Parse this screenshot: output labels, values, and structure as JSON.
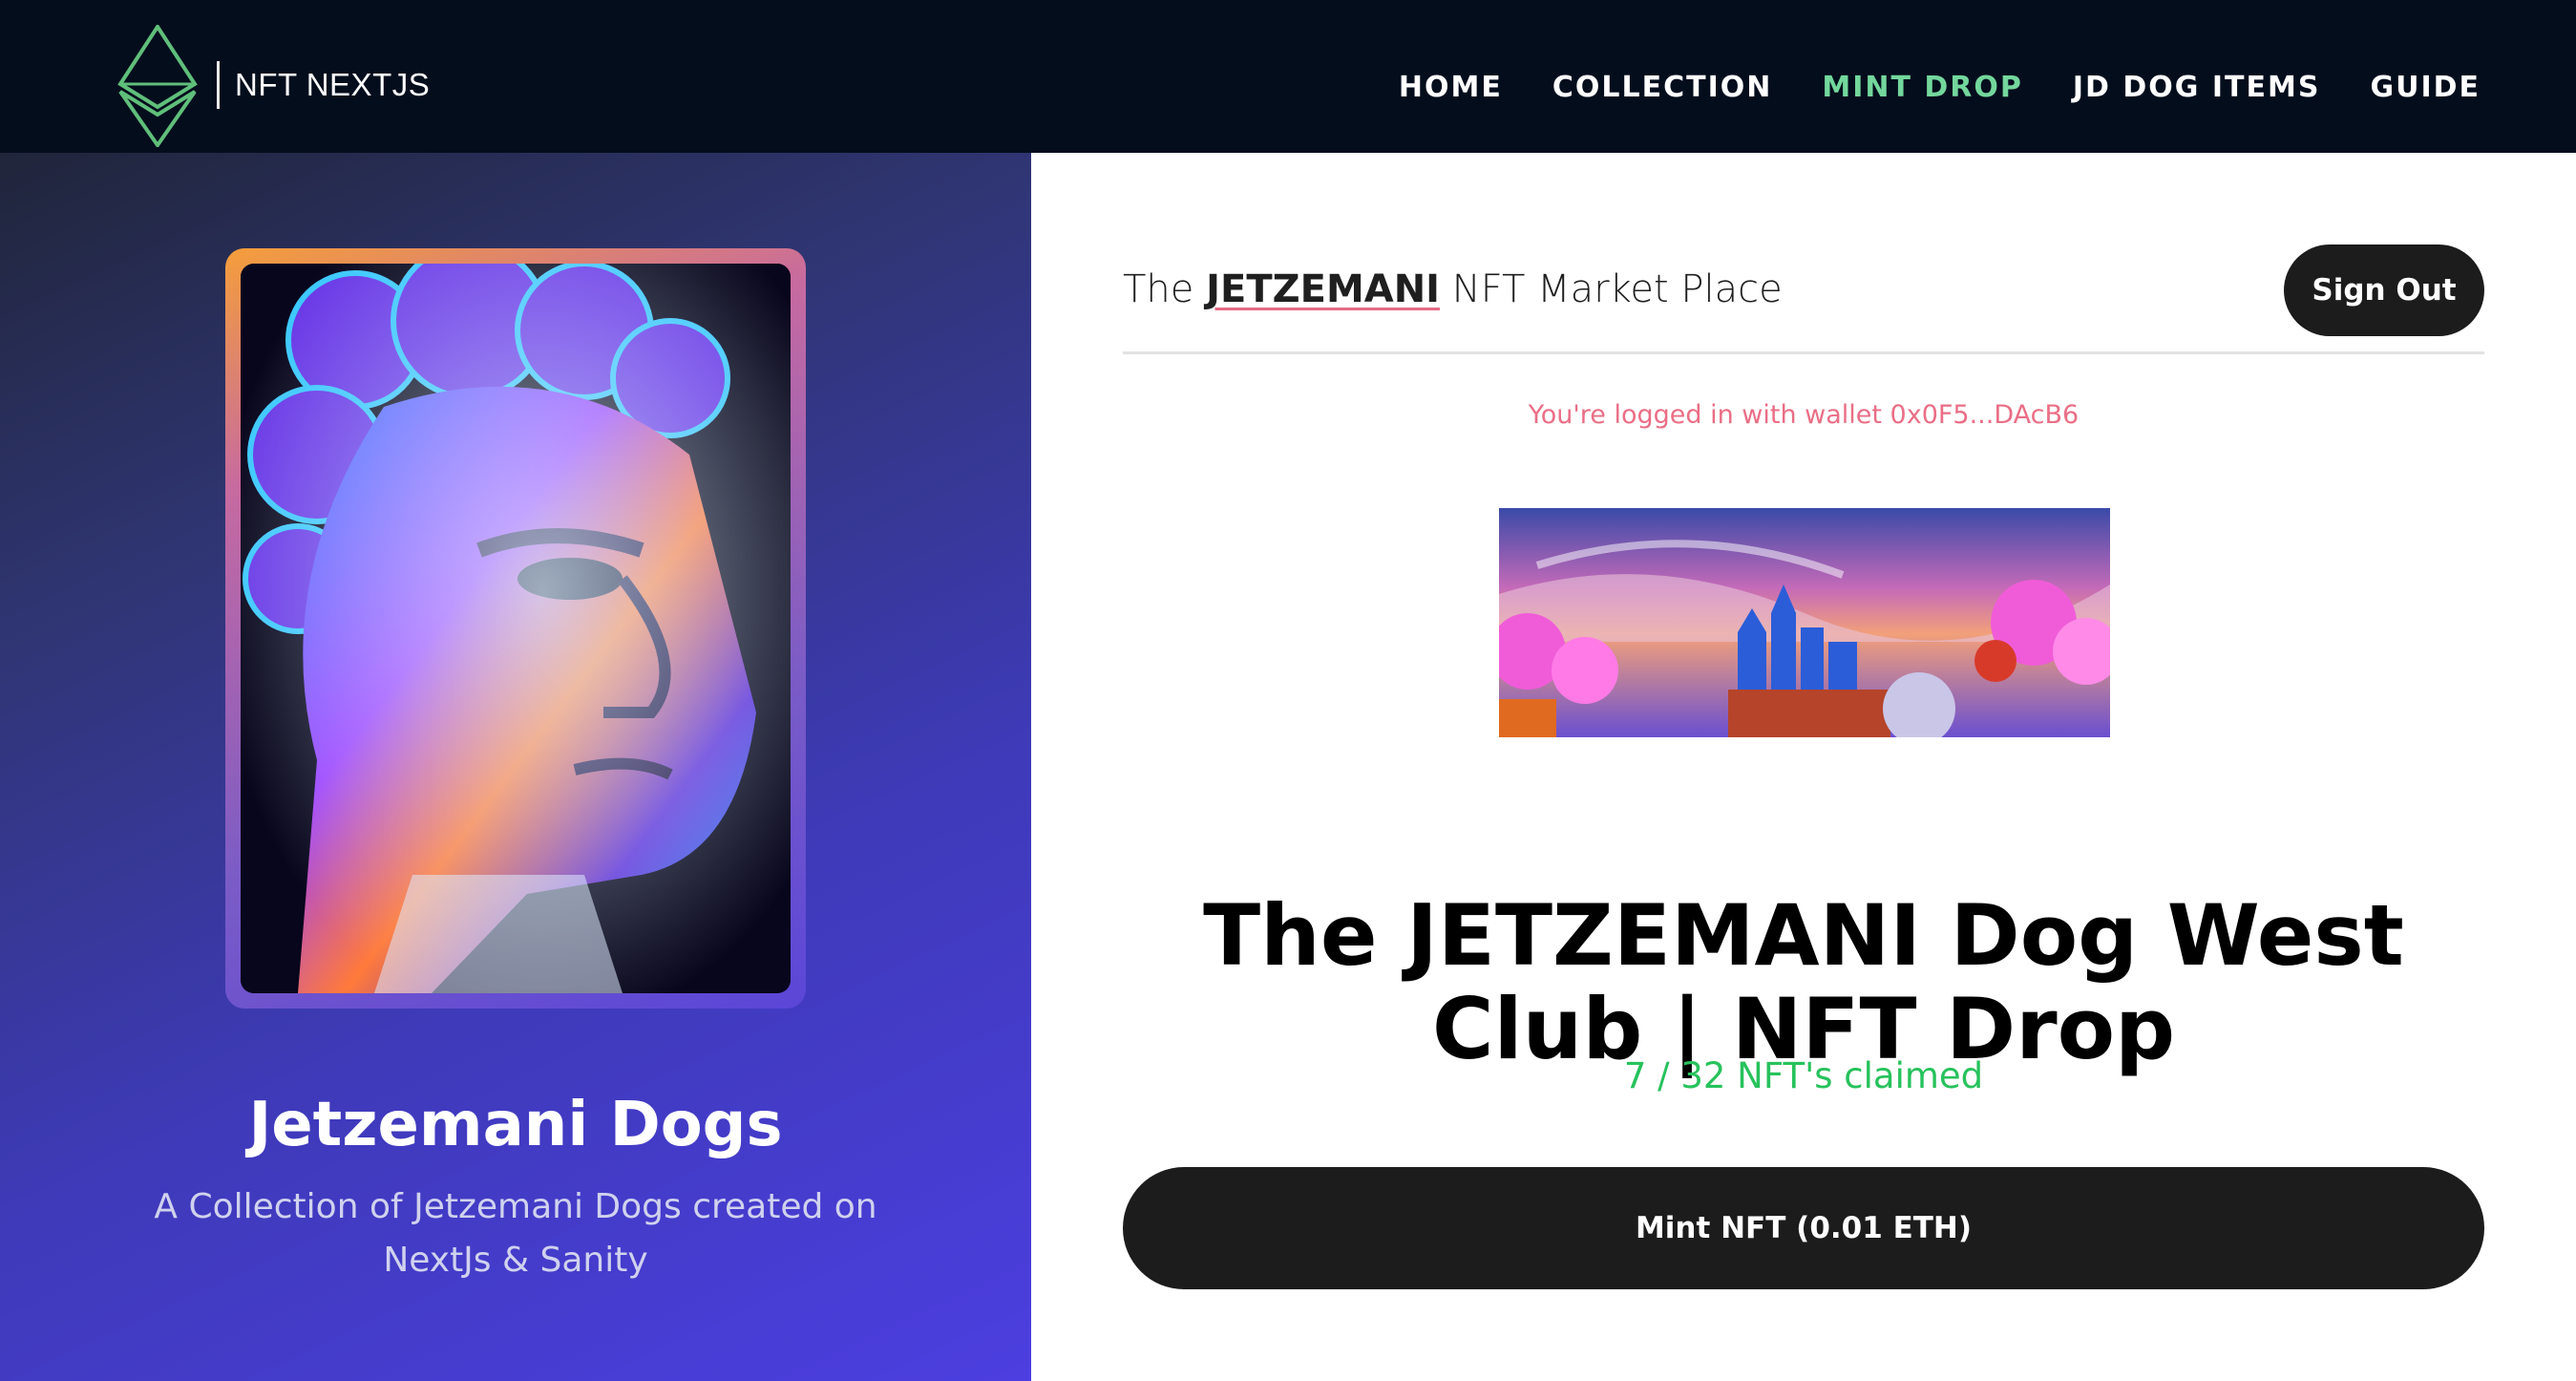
{
  "nav": {
    "brand": "NFT NEXTJS",
    "items": [
      {
        "label": "HOME",
        "active": false
      },
      {
        "label": "COLLECTION",
        "active": false
      },
      {
        "label": "MINT DROP",
        "active": true
      },
      {
        "label": "JD DOG ITEMS",
        "active": false
      },
      {
        "label": "GUIDE",
        "active": false
      }
    ],
    "logo_icon": "ethereum-diamond-icon",
    "active_color": "#73d79c"
  },
  "left": {
    "collection_name": "Jetzemani Dogs",
    "description": "A Collection of Jetzemani Dogs created on NextJs & Sanity"
  },
  "header": {
    "title_prefix": "The",
    "title_brand": "JETZEMANI",
    "title_suffix": "NFT Market Place",
    "signout_label": "Sign Out"
  },
  "wallet": {
    "text": "You're logged in with wallet 0x0F5...DAcB6"
  },
  "drop": {
    "title": "The JETZEMANI Dog West Club | NFT Drop",
    "claimed": "7 / 32 NFT's claimed",
    "mint_label": "Mint NFT (0.01 ETH)"
  },
  "colors": {
    "topbar": "#040d1c",
    "left_panel": "#4c3ee0",
    "wallet_text": "#ea6e86",
    "claimed_text": "#27c25c",
    "button": "#1c1c1c"
  }
}
